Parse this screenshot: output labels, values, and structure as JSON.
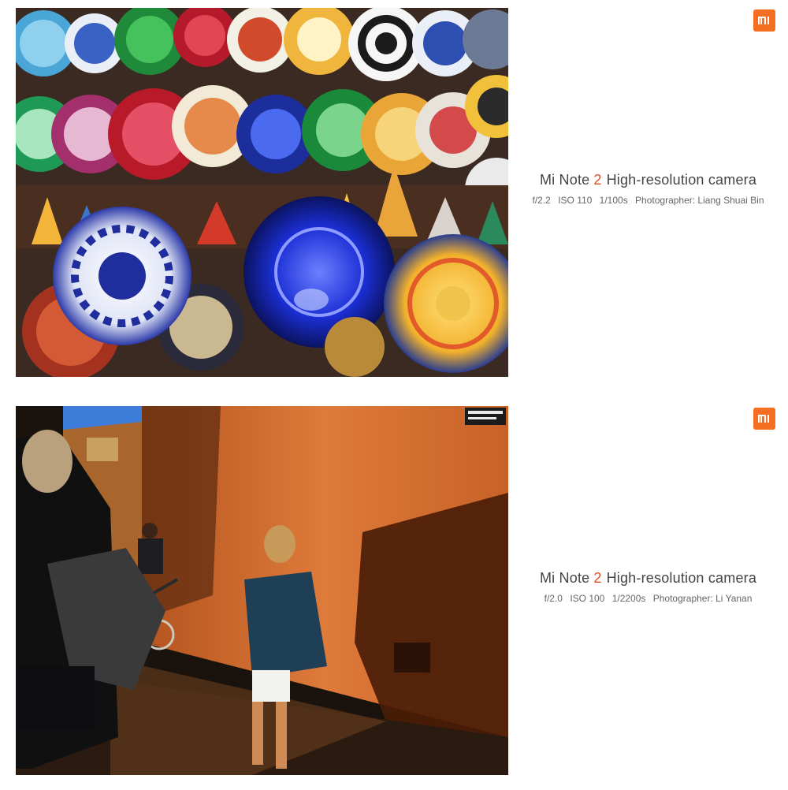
{
  "brand": {
    "logo_text": "MI",
    "color": "#f56f23"
  },
  "cards": [
    {
      "image_alt": "Colorful painted ceramic plates and bowls on a market wall",
      "title_prefix": "Mi Note",
      "title_number": "2",
      "title_suffix": "High-resolution camera",
      "aperture": "f/2.2",
      "iso": "ISO 110",
      "shutter": "1/100s",
      "photographer": "Photographer: Liang Shuai Bin"
    },
    {
      "image_alt": "People walking along a sunlit orange wall with long shadows",
      "title_prefix": "Mi Note",
      "title_number": "2",
      "title_suffix": "High-resolution camera",
      "aperture": "f/2.0",
      "iso": "ISO 100",
      "shutter": "1/2200s",
      "photographer": "Photographer: Li Yanan"
    }
  ],
  "colors": {
    "accent_number": "#e24d1e",
    "text": "#444444"
  }
}
